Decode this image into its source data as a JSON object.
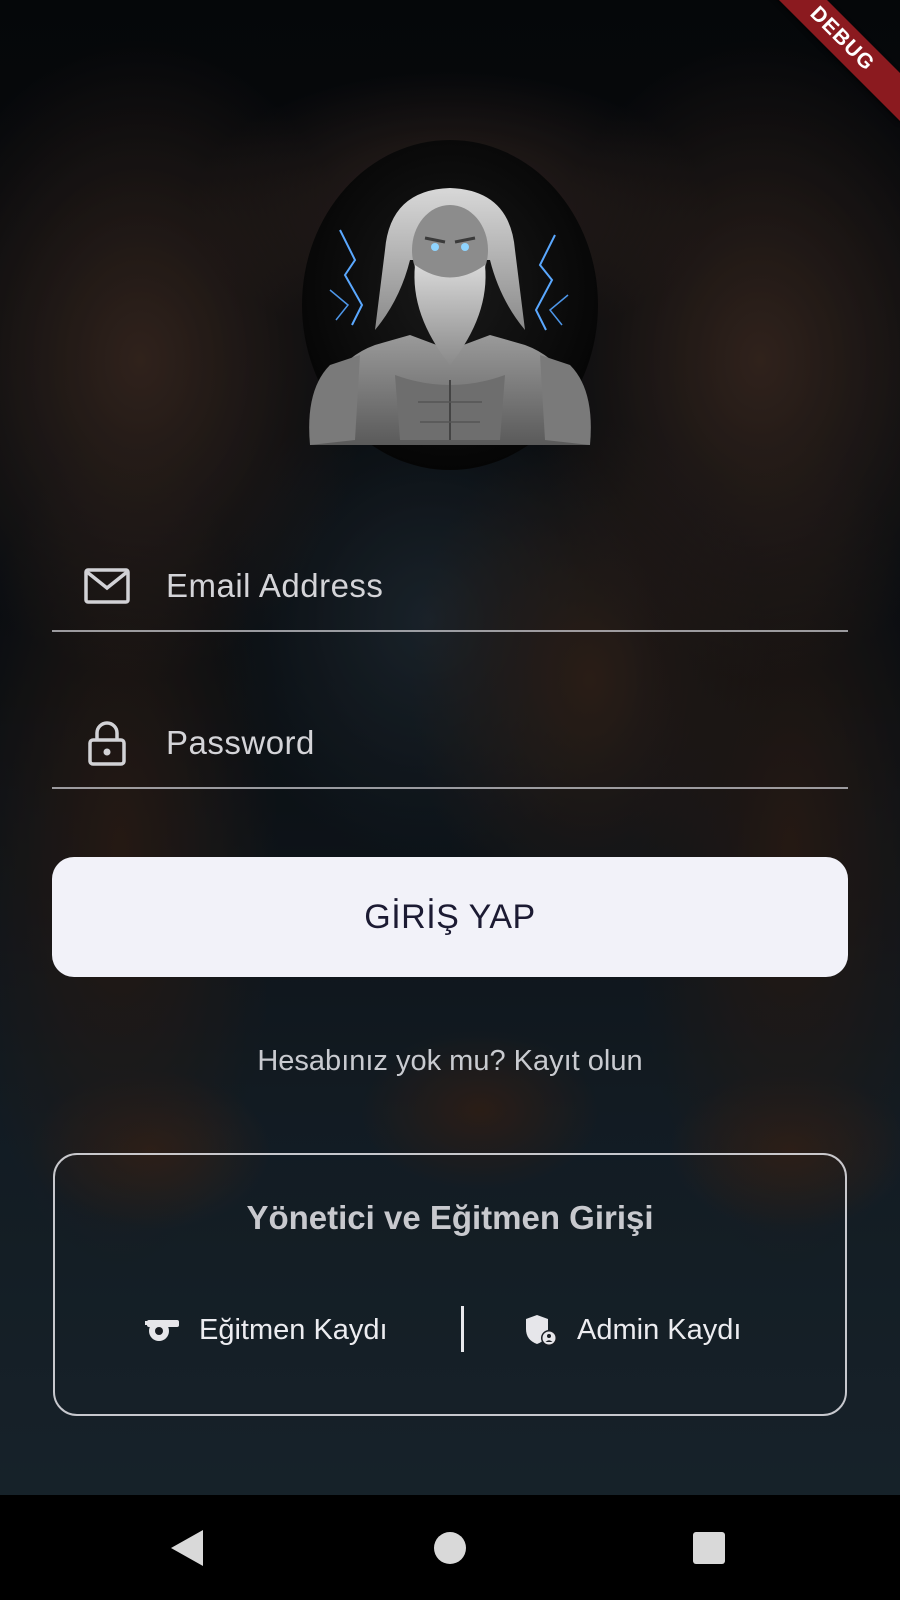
{
  "app": {
    "debug_banner": "DEBUG"
  },
  "login_form": {
    "email_placeholder": "Email Address",
    "password_placeholder": "Password",
    "submit_label": "GİRİŞ YAP",
    "signup_prompt": "Hesabınız yok mu? Kayıt olun"
  },
  "staff_panel": {
    "title": "Yönetici ve Eğitmen Girişi",
    "trainer_register_label": "Eğitmen Kaydı",
    "admin_register_label": "Admin Kaydı"
  },
  "icons": {
    "email": "mail-icon",
    "password": "lock-icon",
    "trainer": "whistle-icon",
    "admin": "admin-shield-icon",
    "nav_back": "back-triangle-icon",
    "nav_home": "home-circle-icon",
    "nav_recents": "recents-square-icon"
  },
  "colors": {
    "button_bg": "#f2f2f9",
    "button_text": "#1c1b33",
    "debug_ribbon": "#8b1a1f"
  }
}
